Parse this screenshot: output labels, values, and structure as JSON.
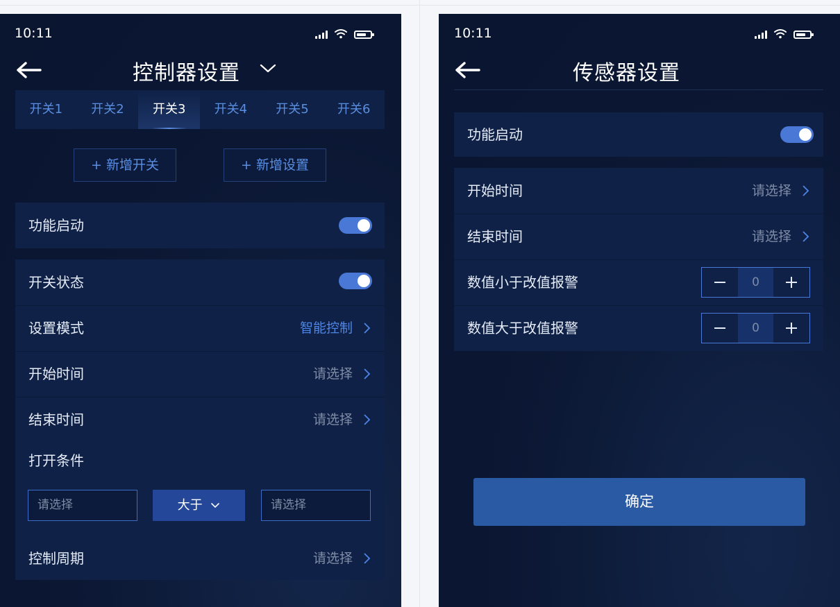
{
  "left": {
    "status_time": "10:11",
    "title": "控制器设置",
    "tabs": [
      "开关1",
      "开关2",
      "开关3",
      "开关4",
      "开关5",
      "开关6"
    ],
    "active_tab": 2,
    "add_switch_label": "+ 新增开关",
    "add_setting_label": "+ 新增设置",
    "function_enable": {
      "label": "功能启动",
      "on": true
    },
    "switch_status": {
      "label": "开关状态",
      "on": true
    },
    "mode": {
      "label": "设置模式",
      "value": "智能控制"
    },
    "start_time": {
      "label": "开始时间",
      "value": "请选择"
    },
    "end_time": {
      "label": "结束时间",
      "value": "请选择"
    },
    "open_condition": {
      "label": "打开条件",
      "left_placeholder": "请选择",
      "operator": "大于",
      "right_placeholder": "请选择"
    },
    "control_cycle": {
      "label": "控制周期",
      "value": "请选择"
    }
  },
  "right": {
    "status_time": "10:11",
    "title": "传感器设置",
    "function_enable": {
      "label": "功能启动",
      "on": true
    },
    "start_time": {
      "label": "开始时间",
      "value": "请选择"
    },
    "end_time": {
      "label": "结束时间",
      "value": "请选择"
    },
    "alarm_below": {
      "label": "数值小于改值报警",
      "value": "0"
    },
    "alarm_above": {
      "label": "数值大于改值报警",
      "value": "0"
    },
    "confirm_label": "确定"
  },
  "colors": {
    "background": "#0b1733",
    "card": "#0f2147",
    "accent": "#4a78d6",
    "link_blue": "#4e86e6",
    "button": "#2a5aa3"
  },
  "icons": [
    "back-arrow-icon",
    "chevron-down-icon",
    "chevron-right-icon",
    "signal-icon",
    "wifi-icon",
    "battery-icon",
    "minus-icon",
    "plus-icon"
  ]
}
